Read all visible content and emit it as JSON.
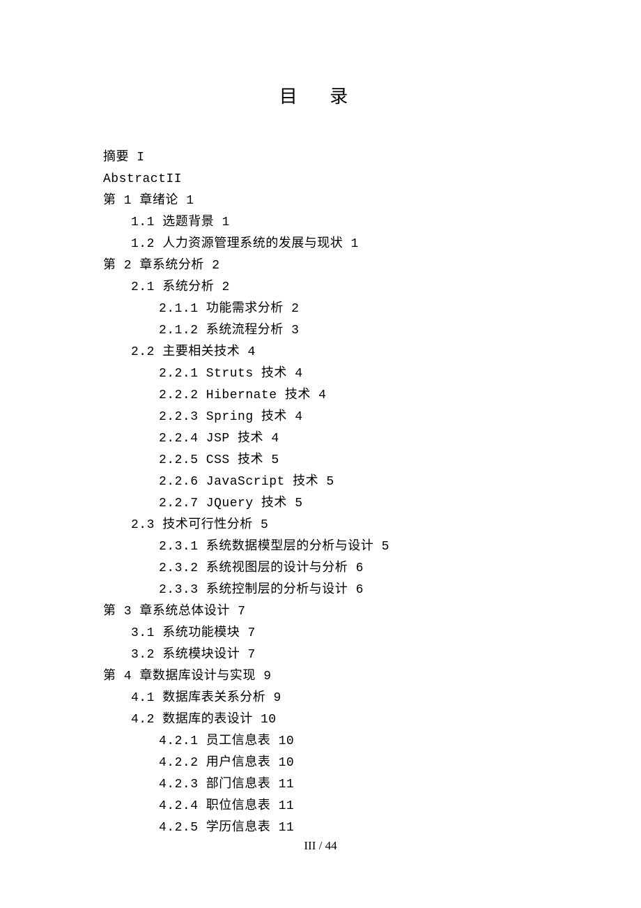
{
  "title": "目 录",
  "footer": "III / 44",
  "entries": [
    {
      "indent": 0,
      "text": "摘要 I"
    },
    {
      "indent": 0,
      "text": "AbstractII"
    },
    {
      "indent": 0,
      "text": "第 1 章绪论 1"
    },
    {
      "indent": 1,
      "text": "1.1 选题背景 1"
    },
    {
      "indent": 1,
      "text": "1.2 人力资源管理系统的发展与现状 1"
    },
    {
      "indent": 0,
      "text": "第 2 章系统分析 2"
    },
    {
      "indent": 1,
      "text": "2.1 系统分析 2"
    },
    {
      "indent": 2,
      "text": "2.1.1 功能需求分析 2"
    },
    {
      "indent": 2,
      "text": "2.1.2 系统流程分析 3"
    },
    {
      "indent": 1,
      "text": "2.2 主要相关技术 4"
    },
    {
      "indent": 2,
      "text": "2.2.1 Struts 技术 4"
    },
    {
      "indent": 2,
      "text": "2.2.2 Hibernate 技术 4"
    },
    {
      "indent": 2,
      "text": "2.2.3 Spring 技术 4"
    },
    {
      "indent": 2,
      "text": "2.2.4 JSP 技术 4"
    },
    {
      "indent": 2,
      "text": "2.2.5 CSS 技术 5"
    },
    {
      "indent": 2,
      "text": "2.2.6 JavaScript 技术 5"
    },
    {
      "indent": 2,
      "text": "2.2.7 JQuery 技术 5"
    },
    {
      "indent": 1,
      "text": "2.3 技术可行性分析 5"
    },
    {
      "indent": 2,
      "text": "2.3.1 系统数据模型层的分析与设计 5"
    },
    {
      "indent": 2,
      "text": "2.3.2 系统视图层的设计与分析 6"
    },
    {
      "indent": 2,
      "text": "2.3.3 系统控制层的分析与设计 6"
    },
    {
      "indent": 0,
      "text": "第 3 章系统总体设计 7"
    },
    {
      "indent": 1,
      "text": "3.1 系统功能模块 7"
    },
    {
      "indent": 1,
      "text": "3.2 系统模块设计 7"
    },
    {
      "indent": 0,
      "text": "第 4 章数据库设计与实现 9"
    },
    {
      "indent": 1,
      "text": "4.1 数据库表关系分析 9"
    },
    {
      "indent": 1,
      "text": "4.2 数据库的表设计 10"
    },
    {
      "indent": 2,
      "text": "4.2.1 员工信息表 10"
    },
    {
      "indent": 2,
      "text": "4.2.2 用户信息表 10"
    },
    {
      "indent": 2,
      "text": "4.2.3 部门信息表 11"
    },
    {
      "indent": 2,
      "text": "4.2.4 职位信息表 11"
    },
    {
      "indent": 2,
      "text": "4.2.5 学历信息表 11"
    }
  ]
}
